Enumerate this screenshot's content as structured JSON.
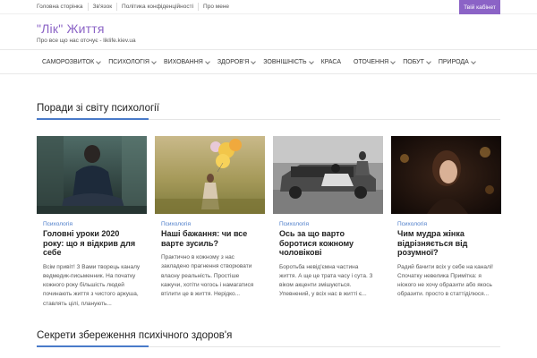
{
  "topbar": {
    "links": [
      "Головна сторінка",
      "Зв'язок",
      "Політика конфіденційності",
      "Про мене"
    ],
    "cabinet_label": "Твій кабінет"
  },
  "brand": {
    "logo": "\"Лік\" Життя",
    "tagline": "Про все що нас оточує - liklife.kiev.ua"
  },
  "nav": {
    "items": [
      {
        "label": "САМОРОЗВИТОК",
        "dropdown": true
      },
      {
        "label": "ПСИХОЛОГІЯ",
        "dropdown": true
      },
      {
        "label": "ВИХОВАННЯ",
        "dropdown": true
      },
      {
        "label": "ЗДОРОВ'Я",
        "dropdown": true
      },
      {
        "label": "ЗОВНІШНІСТЬ",
        "dropdown": true
      },
      {
        "label": "КРАСА",
        "dropdown": false
      },
      {
        "label": "ОТОЧЕННЯ",
        "dropdown": true
      },
      {
        "label": "ПОБУТ",
        "dropdown": true
      },
      {
        "label": "ПРИРОДА",
        "dropdown": true
      }
    ]
  },
  "sections": {
    "first_title": "Поради зі світу психології",
    "second_title": "Секрети збереження психічного здоров'я"
  },
  "cards": [
    {
      "category": "Психологія",
      "title": "Головні уроки 2020 року: що я відкрив для себе",
      "excerpt": "Всім привіт! З Вами творець каналу ведмедик-письменник. На початку кожного року більшість людей починають життя з чистого аркуша, ставлять цілі, планують..."
    },
    {
      "category": "Психологія",
      "title": "Наші бажання: чи все варте зусиль?",
      "excerpt": "Практично в кожному з нас закладено прагнення створювати власну реальність. Простіше кажучи, хотіти чогось і намагатися втілити це в життя. Нерідко..."
    },
    {
      "category": "Психологія",
      "title": "Ось за що варто боротися кожному чоловікові",
      "excerpt": "Боротьба невід'ємна частина життя. А ще це трата часу і сута. З віком акценти змішуються. Упевнений, у всіх нас в житті є..."
    },
    {
      "category": "Психологія",
      "title": "Чим мудра жінка відрізняється від розумної?",
      "excerpt": "Радий бачити всіх у себе на каналі!Спочатку невелика Примітка: я ніокого не хочу образити або якось образити. просто в статтіділюся..."
    }
  ]
}
